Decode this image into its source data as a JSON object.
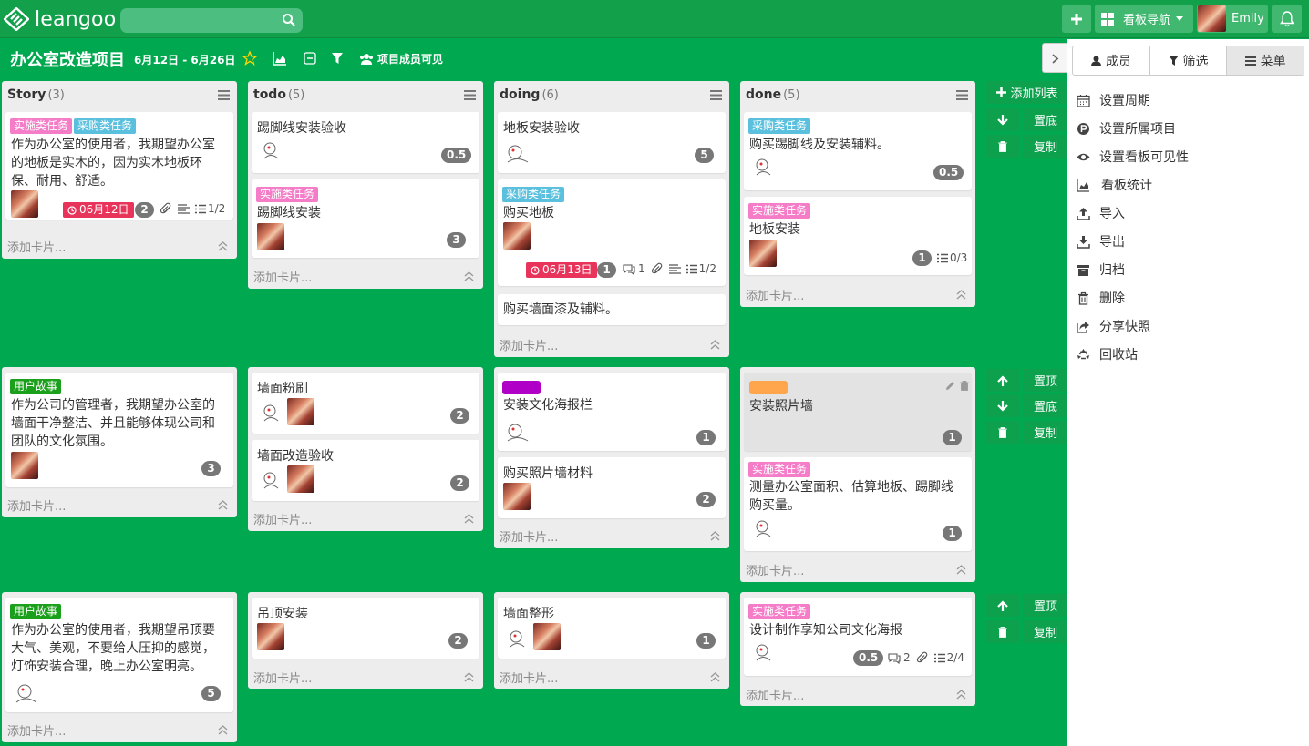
{
  "app": {
    "brand": "leangoo",
    "search_placeholder": "",
    "nav_label": "看板导航",
    "user_name": "Emily"
  },
  "project": {
    "title": "办公室改造项目",
    "dates": "6月12日 - 6月26日",
    "visibility": "项目成员可见"
  },
  "panel": {
    "tabs": [
      "成员",
      "筛选",
      "菜单"
    ],
    "items": [
      "设置周期",
      "设置所属项目",
      "设置看板可见性",
      "看板统计",
      "导入",
      "导出",
      "归档",
      "删除",
      "分享快照",
      "回收站"
    ]
  },
  "lists": [
    {
      "name": "Story",
      "count": "(3)"
    },
    {
      "name": "todo",
      "count": "(5)"
    },
    {
      "name": "doing",
      "count": "(6)"
    },
    {
      "name": "done",
      "count": "(5)"
    }
  ],
  "add_card": "添加卡片...",
  "add_list": "添加列表",
  "actions": {
    "top": "置顶",
    "bottom": "置底",
    "copy": "复制"
  },
  "tags": {
    "impl": "实施类任务",
    "purchase": "采购类任务",
    "story": "用户故事"
  },
  "cards": {
    "r1_story": {
      "title_lines": [
        "作为办公室的使用者，我期望办公室",
        "的地板是实木的，因为实木地板环",
        "保、耐用、舒适。"
      ],
      "due": "06月12日",
      "estimate": "2",
      "checklist": "1/2"
    },
    "r1_todo_1": {
      "title": "踢脚线安装验收",
      "estimate": "0.5"
    },
    "r1_todo_2": {
      "title": "踢脚线安装",
      "estimate": "3"
    },
    "r1_doing_1": {
      "title": "地板安装验收",
      "estimate": "5"
    },
    "r1_doing_2": {
      "title": "购买地板",
      "due": "06月13日",
      "estimate": "1",
      "comments": "1",
      "checklist": "1/2"
    },
    "r1_doing_3": {
      "title": "购买墙面漆及辅料。"
    },
    "r1_done_1": {
      "title": "购买踢脚线及安装辅料。",
      "estimate": "0.5"
    },
    "r1_done_2": {
      "title": "地板安装",
      "estimate": "1",
      "checklist": "0/3"
    },
    "r2_story": {
      "title_lines": [
        "作为公司的管理者，我期望办公室的",
        "墙面干净整洁、并且能够体现公司和",
        "团队的文化氛围。"
      ],
      "estimate": "3"
    },
    "r2_todo_1": {
      "title": "墙面粉刷",
      "estimate": "2"
    },
    "r2_todo_2": {
      "title": "墙面改造验收",
      "estimate": "2"
    },
    "r2_doing_1": {
      "title": "安装文化海报栏",
      "estimate": "1"
    },
    "r2_doing_2": {
      "title": "购买照片墙材料",
      "estimate": "2"
    },
    "r2_done_1": {
      "title": "安装照片墙",
      "estimate": "1"
    },
    "r2_done_2": {
      "title_lines": [
        "测量办公室面积、估算地板、踢脚线",
        "购买量。"
      ],
      "estimate": "1"
    },
    "r3_story": {
      "title_lines": [
        "作为办公室的使用者，我期望吊顶要",
        "大气、美观，不要给人压抑的感觉，",
        "灯饰安装合理，晚上办公室明亮。"
      ],
      "estimate": "5"
    },
    "r3_todo_1": {
      "title": "吊顶安装",
      "estimate": "2"
    },
    "r3_doing_1": {
      "title": "墙面整形",
      "estimate": "1"
    },
    "r3_done_1": {
      "title": "设计制作享知公司文化海报",
      "estimate": "0.5",
      "comments": "2",
      "checklist": "2/4"
    }
  },
  "colors": {
    "board": "#00a84f",
    "topbar": "#12a04b",
    "impl_tag": "#f57dc8",
    "purchase_tag": "#5bc0de",
    "story_tag": "#1aa01a",
    "due": "#e8345a",
    "purple_label": "#b000c8",
    "orange_label": "#ffa64d"
  }
}
